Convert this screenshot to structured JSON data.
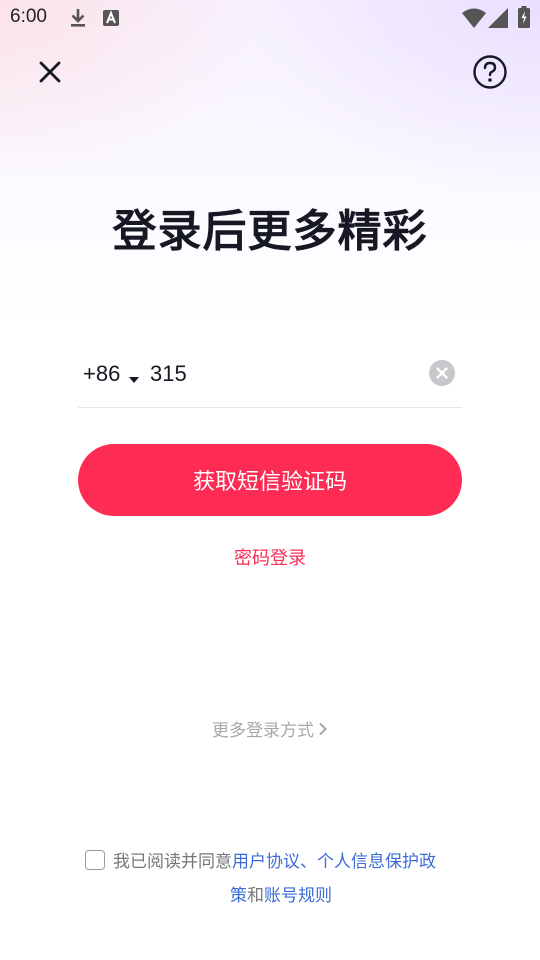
{
  "status_bar": {
    "time": "6:00"
  },
  "icons": {
    "close": "close-icon",
    "help": "help-circle-icon",
    "caret": "caret-down-icon",
    "clear": "clear-input-icon",
    "chevron": "chevron-right-icon"
  },
  "page": {
    "title": "登录后更多精彩"
  },
  "phone": {
    "country_code": "+86",
    "value": "315"
  },
  "actions": {
    "sms_button": "获取短信验证码",
    "password_login": "密码登录",
    "more_methods": "更多登录方式"
  },
  "agreement": {
    "prefix": "我已阅读并同意",
    "user_agreement": "用户协议",
    "separator": "、",
    "privacy_part1": "个人信息保护政",
    "privacy_part2": "策",
    "conjunction": "和",
    "account_rules": "账号规则"
  },
  "colors": {
    "accent": "#fe2c55",
    "link": "#3c6cd8",
    "muted": "#a8a8ab"
  }
}
